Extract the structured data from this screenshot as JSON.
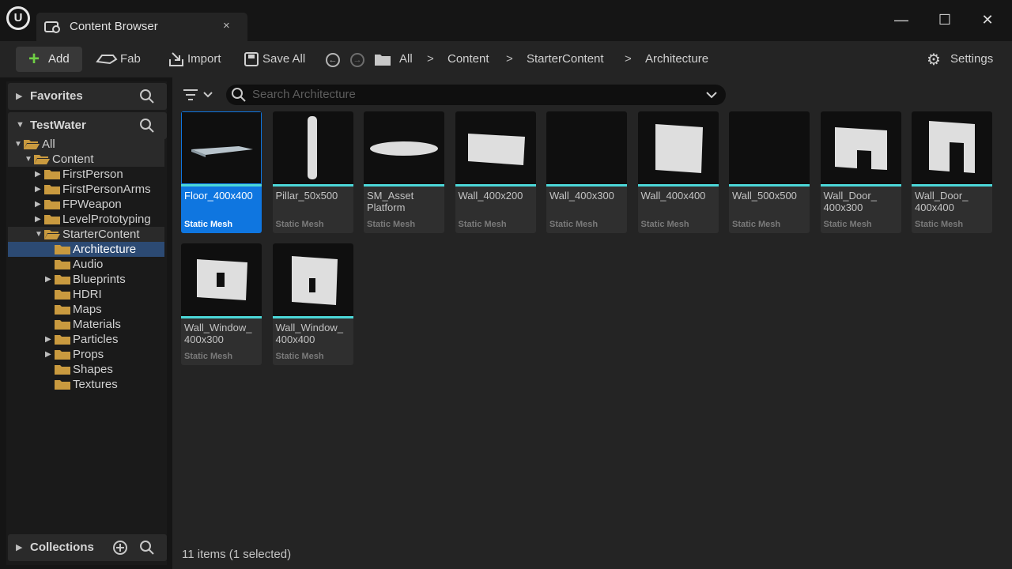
{
  "window": {
    "tab_title": "Content Browser",
    "tab_close": "×",
    "minimize": "—",
    "maximize": "☐",
    "close": "✕"
  },
  "toolbar": {
    "add_label": "Add",
    "fab_label": "Fab",
    "import_label": "Import",
    "save_all_label": "Save All",
    "settings_label": "Settings",
    "breadcrumb": [
      "All",
      "Content",
      "StarterContent",
      "Architecture"
    ],
    "separator": ">"
  },
  "left_panel": {
    "favorites_label": "Favorites",
    "project_label": "TestWater",
    "collections_label": "Collections",
    "tree": [
      {
        "label": "All",
        "depth": 0,
        "expanded": true,
        "has_children": true,
        "state": "parent"
      },
      {
        "label": "Content",
        "depth": 1,
        "expanded": true,
        "has_children": true,
        "state": "parent"
      },
      {
        "label": "FirstPerson",
        "depth": 2,
        "expanded": false,
        "has_children": true,
        "state": ""
      },
      {
        "label": "FirstPersonArms",
        "depth": 2,
        "expanded": false,
        "has_children": true,
        "state": ""
      },
      {
        "label": "FPWeapon",
        "depth": 2,
        "expanded": false,
        "has_children": true,
        "state": ""
      },
      {
        "label": "LevelPrototyping",
        "depth": 2,
        "expanded": false,
        "has_children": true,
        "state": ""
      },
      {
        "label": "StarterContent",
        "depth": 2,
        "expanded": true,
        "has_children": true,
        "state": "parent"
      },
      {
        "label": "Architecture",
        "depth": 3,
        "expanded": false,
        "has_children": false,
        "state": "selected"
      },
      {
        "label": "Audio",
        "depth": 3,
        "expanded": false,
        "has_children": false,
        "state": ""
      },
      {
        "label": "Blueprints",
        "depth": 3,
        "expanded": false,
        "has_children": true,
        "state": ""
      },
      {
        "label": "HDRI",
        "depth": 3,
        "expanded": false,
        "has_children": false,
        "state": ""
      },
      {
        "label": "Maps",
        "depth": 3,
        "expanded": false,
        "has_children": false,
        "state": ""
      },
      {
        "label": "Materials",
        "depth": 3,
        "expanded": false,
        "has_children": false,
        "state": ""
      },
      {
        "label": "Particles",
        "depth": 3,
        "expanded": false,
        "has_children": true,
        "state": ""
      },
      {
        "label": "Props",
        "depth": 3,
        "expanded": false,
        "has_children": true,
        "state": ""
      },
      {
        "label": "Shapes",
        "depth": 3,
        "expanded": false,
        "has_children": false,
        "state": ""
      },
      {
        "label": "Textures",
        "depth": 3,
        "expanded": false,
        "has_children": false,
        "state": ""
      }
    ]
  },
  "main": {
    "search_placeholder": "Search Architecture",
    "status": "11 items (1 selected)",
    "assets": [
      {
        "name": "Floor_400x400",
        "type": "Static Mesh",
        "selected": true,
        "shape": "floor"
      },
      {
        "name": "Pillar_50x500",
        "type": "Static Mesh",
        "selected": false,
        "shape": "pillar"
      },
      {
        "name": "SM_Asset Platform",
        "type": "Static Mesh",
        "selected": false,
        "shape": "platform"
      },
      {
        "name": "Wall_400x200",
        "type": "Static Mesh",
        "selected": false,
        "shape": "wall-wide"
      },
      {
        "name": "Wall_400x300",
        "type": "Static Mesh",
        "selected": false,
        "shape": "empty"
      },
      {
        "name": "Wall_400x400",
        "type": "Static Mesh",
        "selected": false,
        "shape": "wall-square"
      },
      {
        "name": "Wall_500x500",
        "type": "Static Mesh",
        "selected": false,
        "shape": "empty"
      },
      {
        "name": "Wall_Door_ 400x300",
        "type": "Static Mesh",
        "selected": false,
        "shape": "door"
      },
      {
        "name": "Wall_Door_ 400x400",
        "type": "Static Mesh",
        "selected": false,
        "shape": "door-tall"
      },
      {
        "name": "Wall_Window_ 400x300",
        "type": "Static Mesh",
        "selected": false,
        "shape": "window"
      },
      {
        "name": "Wall_Window_ 400x400",
        "type": "Static Mesh",
        "selected": false,
        "shape": "window-tall"
      }
    ]
  },
  "colors": {
    "accent": "#0f76e0",
    "asset_bar": "#4bd7d8",
    "add_plus": "#6fcf45",
    "folder": "#c99a3f"
  }
}
